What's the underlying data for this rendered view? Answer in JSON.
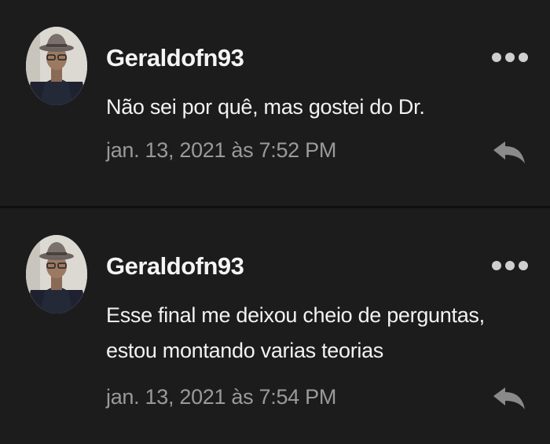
{
  "comments": [
    {
      "username": "Geraldofn93",
      "text_lines": [
        "Não sei por quê, mas gostei do Dr."
      ],
      "timestamp": "jan. 13, 2021 às 7:52 PM",
      "avatar_icon": "user-avatar-photo",
      "menu_icon": "more-options-icon",
      "reply_icon": "reply-arrow-icon"
    },
    {
      "username": "Geraldofn93",
      "text_lines": [
        "Esse final me deixou cheio de perguntas,",
        "estou montando varias teorias"
      ],
      "timestamp": "jan. 13, 2021 às 7:54 PM",
      "avatar_icon": "user-avatar-photo",
      "menu_icon": "more-options-icon",
      "reply_icon": "reply-arrow-icon"
    }
  ],
  "colors": {
    "background": "#1c1c1c",
    "divider": "#101010",
    "username": "#f4f4f4",
    "text": "#f2f2f2",
    "timestamp": "#9a9a9a",
    "icon": "#cfcfcf"
  }
}
